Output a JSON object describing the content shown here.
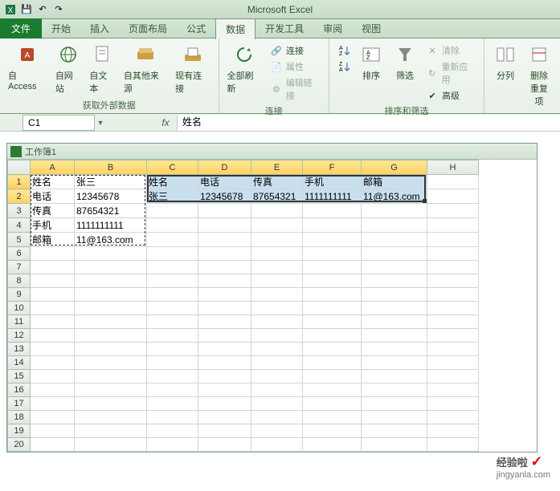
{
  "app_title": "Microsoft Excel",
  "qat": {
    "save": "💾",
    "undo": "↶",
    "redo": "↷"
  },
  "tabs": {
    "file": "文件",
    "items": [
      "开始",
      "插入",
      "页面布局",
      "公式",
      "数据",
      "开发工具",
      "审阅",
      "视图"
    ],
    "active_index": 4
  },
  "ribbon": {
    "group1": {
      "label": "获取外部数据",
      "btns": [
        "自 Access",
        "自网站",
        "自文本",
        "自其他来源",
        "现有连接"
      ]
    },
    "group2": {
      "label": "连接",
      "refresh": "全部刷新",
      "conn": "连接",
      "prop": "属性",
      "edit": "编辑链接"
    },
    "group3": {
      "label": "排序和筛选",
      "az": "A↓Z",
      "za": "Z↓A",
      "sort": "排序",
      "filter": "筛选",
      "clear": "清除",
      "reapply": "重新应用",
      "adv": "高级"
    },
    "group4": {
      "label": "",
      "split": "分列",
      "dedup": "删除\n重复项"
    }
  },
  "namebox": "C1",
  "formula": "姓名",
  "workbook_title": "工作簿1",
  "columns": [
    "A",
    "B",
    "C",
    "D",
    "E",
    "F",
    "G",
    "H"
  ],
  "sel_cols": [
    0,
    1,
    2,
    3,
    4,
    5,
    6
  ],
  "sel_rows": [
    1,
    2
  ],
  "grid": {
    "r1": {
      "A": "姓名",
      "B": "张三",
      "C": "姓名",
      "D": "电话",
      "E": "传真",
      "F": "手机",
      "G": "邮箱"
    },
    "r2": {
      "A": "电话",
      "B": "12345678",
      "C": "张三",
      "D": "12345678",
      "E": "87654321",
      "F": "1111111111",
      "G": "11@163.com"
    },
    "r3": {
      "A": "传真",
      "B": "87654321"
    },
    "r4": {
      "A": "手机",
      "B": "1111111111"
    },
    "r5": {
      "A": "邮箱",
      "B": "11@163.com"
    }
  },
  "watermark": {
    "text": "经验啦",
    "url": "jingyanla.com"
  }
}
